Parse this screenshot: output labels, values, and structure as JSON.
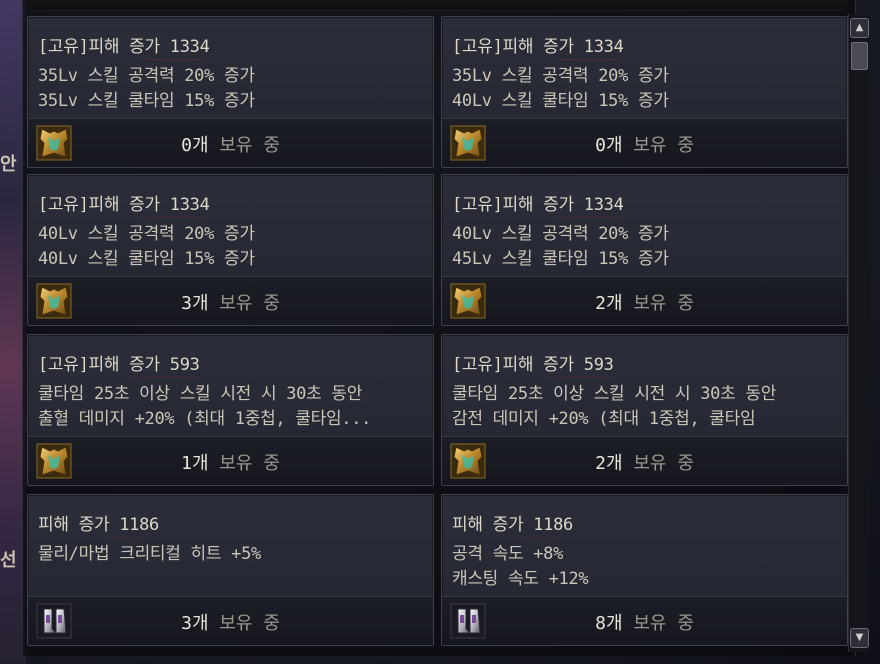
{
  "background": {
    "left_glyphs": [
      "안",
      "선"
    ]
  },
  "cards": [
    {
      "title": "[고유]피해 증가 1334",
      "lines": [
        "35Lv 스킬 공격력 20% 증가",
        "35Lv 스킬 쿨타임 15% 증가"
      ],
      "count": "0개",
      "count_suffix": "보유 중",
      "icon": "gold-armor-icon"
    },
    {
      "title": "[고유]피해 증가 1334",
      "lines": [
        "35Lv 스킬 공격력 20% 증가",
        "40Lv 스킬 쿨타임 15% 증가"
      ],
      "count": "0개",
      "count_suffix": "보유 중",
      "icon": "gold-armor-icon"
    },
    {
      "title": "[고유]피해 증가 1334",
      "lines": [
        "40Lv 스킬 공격력 20% 증가",
        "40Lv 스킬 쿨타임 15% 증가"
      ],
      "count": "3개",
      "count_suffix": "보유 중",
      "icon": "gold-armor-icon"
    },
    {
      "title": "[고유]피해 증가 1334",
      "lines": [
        "40Lv 스킬 공격력 20% 증가",
        "45Lv 스킬 쿨타임 15% 증가"
      ],
      "count": "2개",
      "count_suffix": "보유 중",
      "icon": "gold-armor-icon"
    },
    {
      "title": "[고유]피해 증가 593",
      "lines": [
        "쿨타임 25초 이상 스킬 시전 시 30초 동안",
        "출혈 데미지 +20% (최대 1중첩, 쿨타임..."
      ],
      "count": "1개",
      "count_suffix": "보유 중",
      "icon": "gold-armor-icon"
    },
    {
      "title": "[고유]피해 증가 593",
      "lines": [
        "쿨타임 25초 이상 스킬 시전 시 30초 동안",
        "감전 데미지 +20% (최대 1중첩, 쿨타임"
      ],
      "count": "2개",
      "count_suffix": "보유 중",
      "icon": "gold-armor-icon"
    },
    {
      "title": "피해 증가 1186",
      "lines": [
        "물리/마법 크리티컬 히트 +5%"
      ],
      "count": "3개",
      "count_suffix": "보유 중",
      "icon": "silver-boots-icon"
    },
    {
      "title": "피해 증가 1186",
      "lines": [
        "공격 속도 +8%",
        "캐스팅 속도 +12%"
      ],
      "count": "8개",
      "count_suffix": "보유 중",
      "icon": "silver-boots-icon"
    }
  ],
  "scrollbar": {
    "up": "▲",
    "down": "▼"
  },
  "colors": {
    "underline": "#d81418",
    "text": "#c9c6b8",
    "count_label": "#9a9890"
  }
}
